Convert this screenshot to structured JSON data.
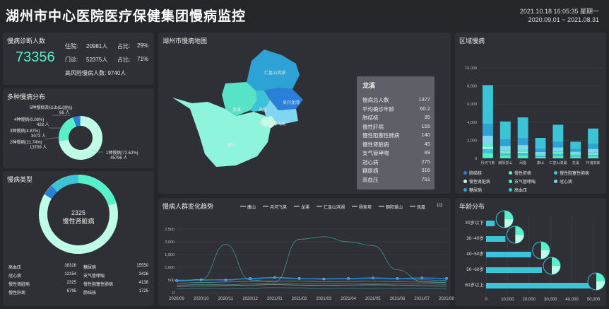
{
  "header": {
    "title": "湖州市中心医院医疗保健集团慢病监控",
    "datetime": "2021.10.18 16:05:35 星期一",
    "range": "2020.09.01 ~ 2021.08.31"
  },
  "diag": {
    "title": "慢病诊断人数",
    "total": "73356",
    "inpatient_label": "住院:",
    "inpatient": "20981人",
    "inpatient_pct_label": "占比:",
    "inpatient_pct": "29%",
    "outpatient_label": "门诊:",
    "outpatient": "52375人",
    "outpatient_pct_label": "占比:",
    "outpatient_pct": "71%",
    "high_risk": "高风险慢病人数: 9740人"
  },
  "multi": {
    "title": "多种慢病分布",
    "labels": [
      {
        "name": "5种慢病及以上(0.09%)",
        "value": "66 人"
      },
      {
        "name": "4种慢病(0.08%)",
        "value": "428 人"
      },
      {
        "name": "3种慢病(4.87%)",
        "value": "3073 人"
      },
      {
        "name": "2种慢病(21.74%)",
        "value": "13709 人"
      },
      {
        "name": "1种慢病(72.62%)",
        "value": "45796 人"
      }
    ],
    "shares": [
      72.62,
      21.74,
      4.87,
      0.68,
      0.09
    ]
  },
  "types": {
    "title": "慢病类型",
    "center_value": "2325",
    "center_label": "慢性肾脏病",
    "rows": [
      [
        "高血压",
        "38326",
        "糖尿病",
        "15550"
      ],
      [
        "冠心病",
        "12154",
        "支气管哮喘",
        "3426"
      ],
      [
        "慢性肾脏病",
        "2325",
        "慢性阻塞性肺病",
        "4138"
      ],
      [
        "慢性肝病",
        "6795",
        "肺结核",
        "1725"
      ]
    ]
  },
  "map": {
    "title": "湖州市慢病地图",
    "regions": [
      "仁皇山滨湖",
      "龙溪",
      "凤凰",
      "吴兴龙湾",
      "月河飞英",
      "朝阳爱山",
      "康山"
    ],
    "tooltip": {
      "title": "龙溪",
      "rows": [
        [
          "慢病总人数",
          "1377"
        ],
        [
          "平均确诊年龄",
          "60.2"
        ],
        [
          "肺结核",
          "35"
        ],
        [
          "慢性肝病",
          "155"
        ],
        [
          "慢性阻塞性肺病",
          "140"
        ],
        [
          "慢性肾脏病",
          "45"
        ],
        [
          "支气管哮喘",
          "89"
        ],
        [
          "冠心病",
          "275"
        ],
        [
          "糖尿病",
          "316"
        ],
        [
          "高血压",
          "791"
        ]
      ]
    }
  },
  "region": {
    "title": "区域慢病"
  },
  "trend": {
    "title": "慢病人群变化趋势",
    "legend": [
      "康山",
      "月河飞英",
      "龙溪",
      "仁皇山滨湖",
      "杨家埠",
      "朝阳爱山",
      "凤凰"
    ],
    "page": "1/2"
  },
  "age": {
    "title": "年龄分布",
    "groups": [
      "30岁以下",
      "30~40岁",
      "40~50岁",
      "50~60岁",
      "60岁以上"
    ],
    "values": [
      4000,
      9000,
      21000,
      26000,
      50000
    ],
    "xticks": [
      "0",
      "10,000",
      "20,000",
      "30,000",
      "40,000",
      "50,000"
    ]
  },
  "chart_data": [
    {
      "type": "bar",
      "title": "区域慢病",
      "categories": [
        "月河飞英",
        "朝阳爱山",
        "凤凰",
        "康山",
        "仁皇山滨湖",
        "龙溪",
        "环渚高新"
      ],
      "ylim": [
        0,
        10000
      ],
      "yticks": [
        "0",
        "2,000",
        "4,000",
        "6,000",
        "8,000",
        "10,000"
      ],
      "series": [
        {
          "name": "肺结核",
          "values": [
            50,
            30,
            30,
            25,
            35,
            35,
            30
          ]
        },
        {
          "name": "慢性肝病",
          "values": [
            550,
            300,
            300,
            150,
            250,
            155,
            200
          ]
        },
        {
          "name": "慢性阻塞性肺病",
          "values": [
            450,
            250,
            300,
            130,
            230,
            140,
            200
          ]
        },
        {
          "name": "慢性肾脏病",
          "values": [
            200,
            100,
            100,
            60,
            80,
            45,
            70
          ]
        },
        {
          "name": "支气管哮喘",
          "values": [
            350,
            200,
            200,
            100,
            170,
            89,
            150
          ]
        },
        {
          "name": "冠心病",
          "values": [
            900,
            500,
            550,
            250,
            450,
            275,
            400
          ]
        },
        {
          "name": "糖尿病",
          "values": [
            1300,
            700,
            750,
            350,
            600,
            316,
            550
          ]
        },
        {
          "name": "高血压",
          "values": [
            4300,
            2000,
            2300,
            1200,
            1900,
            791,
            1700
          ]
        }
      ]
    },
    {
      "type": "line",
      "title": "慢病人群变化趋势",
      "x": [
        "2020/09",
        "2020/10",
        "2020/11",
        "2020/12",
        "2021/01",
        "2021/02",
        "2021/03",
        "2021/04",
        "2021/05",
        "2021/06",
        "2021/07",
        "2021/08"
      ],
      "ylim": [
        0,
        2500
      ],
      "yticks": [
        "0",
        "500",
        "1,000",
        "1,500",
        "2,000",
        "2,500"
      ],
      "series": [
        {
          "name": "康山",
          "values": [
            480,
            510,
            500,
            560,
            600,
            560,
            540,
            560,
            580,
            560,
            580,
            560
          ]
        },
        {
          "name": "月河飞英",
          "values": [
            450,
            520,
            1900,
            500,
            420,
            2100,
            2200,
            2000,
            1850,
            900,
            450,
            480
          ]
        },
        {
          "name": "龙溪",
          "values": [
            300,
            320,
            310,
            350,
            380,
            360,
            350,
            360,
            340,
            360,
            350,
            330
          ]
        },
        {
          "name": "仁皇山滨湖",
          "values": [
            250,
            260,
            280,
            300,
            320,
            300,
            290,
            300,
            310,
            300,
            280,
            260
          ]
        },
        {
          "name": "杨家埠",
          "values": [
            150,
            170,
            160,
            180,
            200,
            190,
            170,
            180,
            160,
            170,
            180,
            160
          ]
        },
        {
          "name": "朝阳爱山",
          "values": [
            500,
            480,
            520,
            540,
            570,
            550,
            560,
            540,
            560,
            550,
            520,
            460
          ]
        },
        {
          "name": "凤凰",
          "values": [
            380,
            400,
            420,
            440,
            460,
            450,
            430,
            440,
            450,
            430,
            420,
            400
          ]
        }
      ]
    }
  ],
  "colors": {
    "primary": "#3bc3d8",
    "accent": "#56f0c9",
    "light": "#bfffe8",
    "blue": "#2a7fd8",
    "bg": "#252629",
    "panel": "#2f3035"
  },
  "legend_region": [
    "肺结核",
    "慢性肝病",
    "慢性阻塞性肺病",
    "慢性肾脏病",
    "支气管哮喘",
    "冠心病",
    "糖尿病",
    "高血压"
  ]
}
